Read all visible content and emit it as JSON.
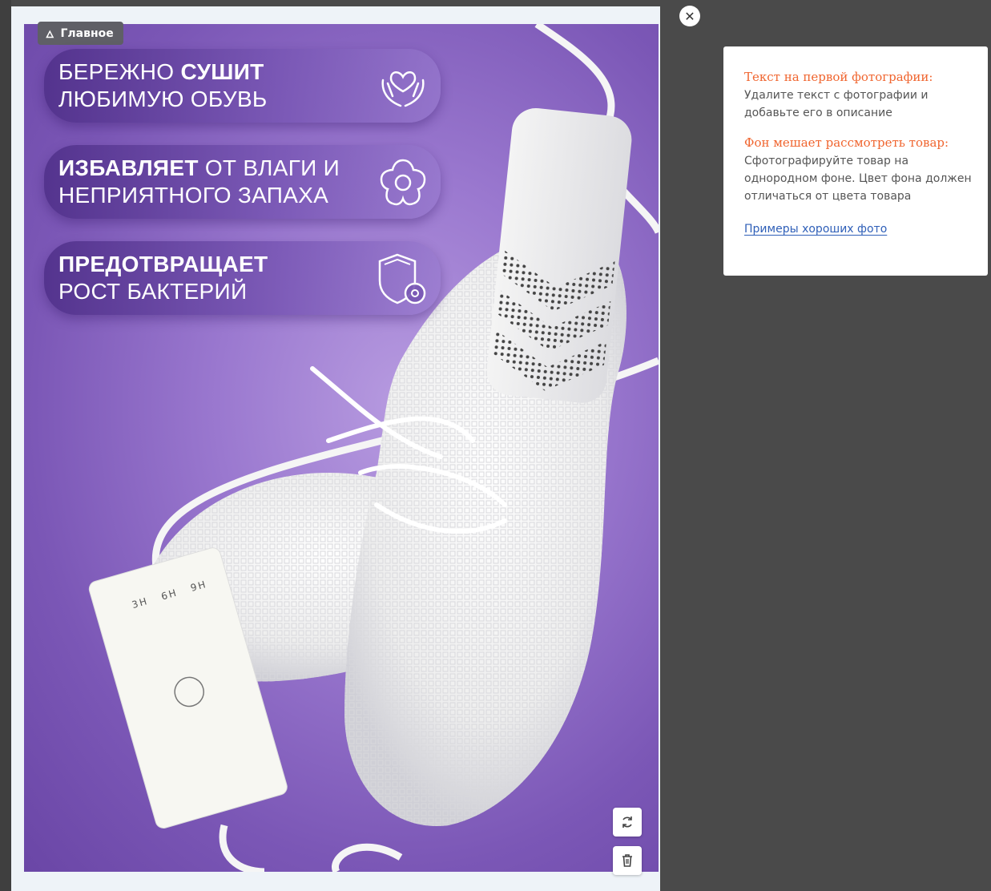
{
  "badge": {
    "icon": "fire-icon",
    "label": "Главное"
  },
  "features": [
    {
      "pre": "БЕРЕЖНО ",
      "bold": "СУШИТ",
      "line2": "ЛЮБИМУЮ ОБУВЬ",
      "icon": "hands-heart-icon"
    },
    {
      "bold": "ИЗБАВЛЯЕТ",
      "rest": " ОТ ВЛАГИ И",
      "line2": "НЕПРИЯТНОГО ЗАПАХА",
      "icon": "flower-icon"
    },
    {
      "bold": "ПРЕДОТВРАЩАЕТ",
      "line2": "РОСТ БАКТЕРИЙ",
      "icon": "shield-icon"
    }
  ],
  "remote": {
    "labels": [
      "3H",
      "6H",
      "9H"
    ]
  },
  "hint": {
    "title1": "Текст на первой фотографии:",
    "text1": "Удалите текст с фотографии и добавьте его в описание",
    "title2": "Фон мешает рассмотреть товар:",
    "text2": "Сфотографируйте товар на однородном фоне. Цвет фона должен отличаться от цвета товара",
    "link": "Примеры хороших фото"
  },
  "colors": {
    "warning": "#f0652f",
    "link": "#2f5fb8",
    "background": "#4a4a4a"
  }
}
